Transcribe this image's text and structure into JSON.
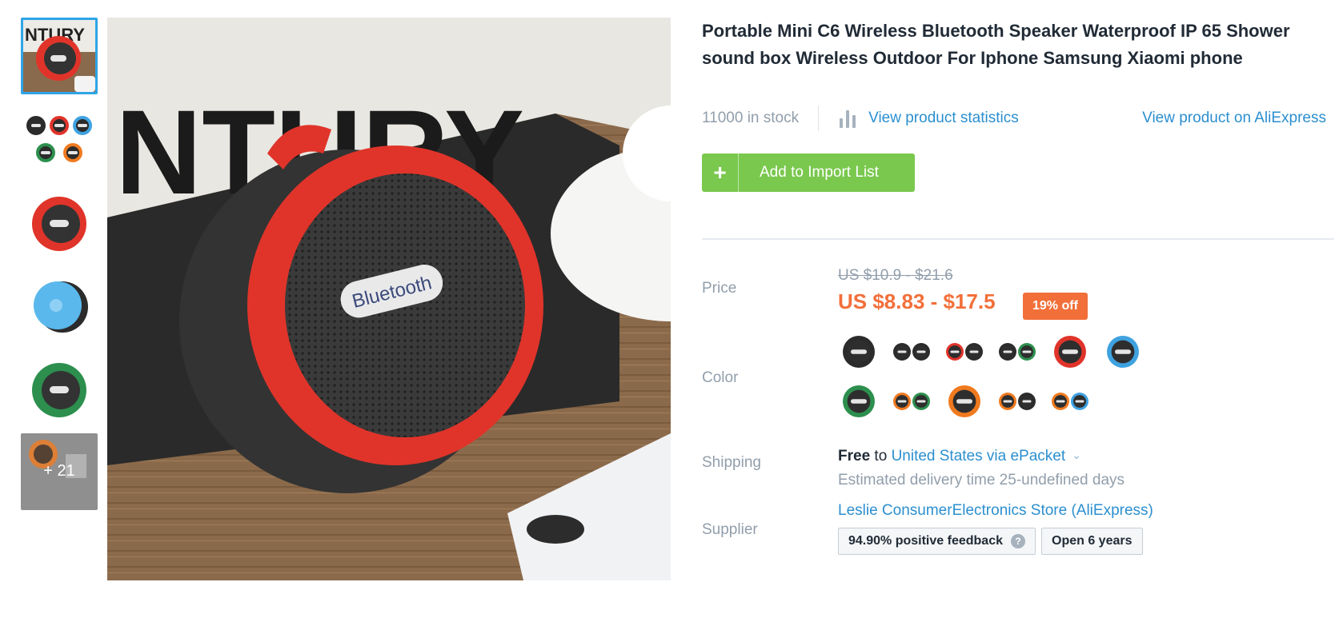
{
  "product": {
    "title": "Portable Mini C6 Wireless Bluetooth Speaker Waterproof IP 65 Shower sound box Wireless Outdoor For Iphone Samsung Xiaomi phone",
    "main_image": "product-photo-red-speaker",
    "main_image_printed_text": [
      "NTURY",
      "Bluetooth"
    ]
  },
  "thumbnails": [
    {
      "name": "red-speaker-photo",
      "active": true
    },
    {
      "name": "five-color-speakers"
    },
    {
      "name": "red-speaker"
    },
    {
      "name": "blue-speaker"
    },
    {
      "name": "green-speaker"
    },
    {
      "name": "orange-speaker-accessories",
      "more_label": "+ 21"
    }
  ],
  "meta": {
    "stock": "11000 in stock",
    "stats_link": "View product statistics",
    "ali_link": "View product on AliExpress"
  },
  "actions": {
    "add_label": "Add to Import List",
    "add_icon": "+"
  },
  "price": {
    "label": "Price",
    "old": "US $10.9 - $21.6",
    "new": "US $8.83 - $17.5",
    "discount": "19% off"
  },
  "color": {
    "label": "Color",
    "swatches": [
      {
        "ring": "#2b2b2b",
        "body": "#3a3a3a"
      },
      {
        "ring": "#2b2b2b",
        "body": "#2b2b2b",
        "pair": true
      },
      {
        "ring": "#e0342a",
        "body": "#2b2b2b",
        "pair": true
      },
      {
        "ring": "#2b2b2b",
        "body": "#2d8f4e",
        "pair": true
      },
      {
        "ring": "#e0342a",
        "body": "#2b2b2b"
      },
      {
        "ring": "#3fa2e0",
        "body": "#2b2b2b"
      },
      {
        "ring": "#2d8f4e",
        "body": "#2b2b2b"
      },
      {
        "ring": "#f07a1f",
        "body": "#2d8f4e",
        "pair": true
      },
      {
        "ring": "#f07a1f",
        "body": "#2b2b2b"
      },
      {
        "ring": "#f07a1f",
        "body": "#2b2b2b",
        "pair": true
      },
      {
        "ring": "#f07a1f",
        "body": "#3fa2e0",
        "pair": true
      }
    ]
  },
  "shipping": {
    "label": "Shipping",
    "free": "Free",
    "to": "to",
    "destination": "United States via ePacket",
    "estimate": "Estimated delivery time 25-undefined days"
  },
  "supplier": {
    "label": "Supplier",
    "name": "Leslie ConsumerElectronics Store (AliExpress)",
    "feedback": "94.90% positive feedback",
    "help": "?",
    "open": "Open 6 years"
  },
  "colors": {
    "accent_blue": "#2b8fcf",
    "price_orange": "#f26f3a",
    "button_green": "#7ac84e"
  }
}
